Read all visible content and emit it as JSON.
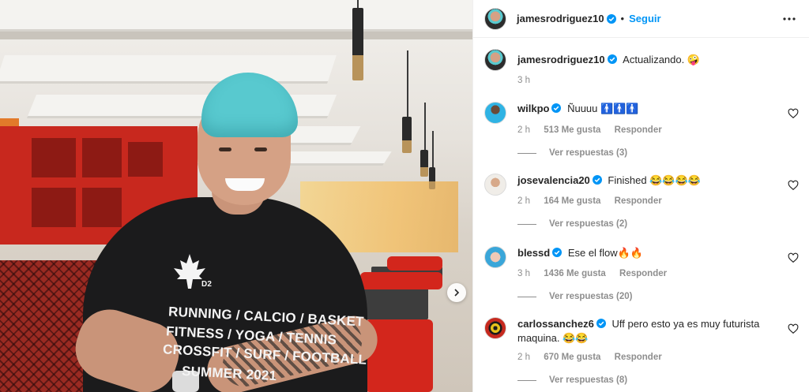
{
  "post": {
    "author": "jamesrodriguez10",
    "follow_label": "Seguir",
    "separator": "•",
    "caption": "Actualizando. 🤪",
    "caption_time": "3 h",
    "shirt_lines": [
      "RUNNING / CALCIO / BASKET",
      "FITNESS / YOGA / TENNIS",
      "CROSSFIT / SURF / FOOTBALL",
      "SUMMER  2021"
    ],
    "shirt_badge": "D2"
  },
  "comments": [
    {
      "user": "wilkpo",
      "text": "Ñuuuu 🚹🚹🚹",
      "time": "2 h",
      "likes": "513 Me gusta",
      "reply": "Responder",
      "replies": "Ver respuestas (3)"
    },
    {
      "user": "josevalencia20",
      "text": "Finished 😂😂😂😂",
      "time": "2 h",
      "likes": "164 Me gusta",
      "reply": "Responder",
      "replies": "Ver respuestas (2)"
    },
    {
      "user": "blessd",
      "text": "Ese el flow🔥🔥",
      "time": "3 h",
      "likes": "1436 Me gusta",
      "reply": "Responder",
      "replies": "Ver respuestas (20)"
    },
    {
      "user": "carlossanchez6",
      "text": "Uff pero esto ya es muy futurista maquina. 😂😂",
      "time": "2 h",
      "likes": "670 Me gusta",
      "reply": "Responder",
      "replies": "Ver respuestas (8)"
    }
  ],
  "colors": {
    "accent": "#0095f6",
    "verified": "#0095f6",
    "hair": "#58c9cf",
    "chair_red": "#d3261c"
  },
  "icons": {
    "verified": "verified-badge-icon",
    "more": "more-options-icon",
    "heart": "heart-outline-icon",
    "next": "chevron-right-icon"
  }
}
